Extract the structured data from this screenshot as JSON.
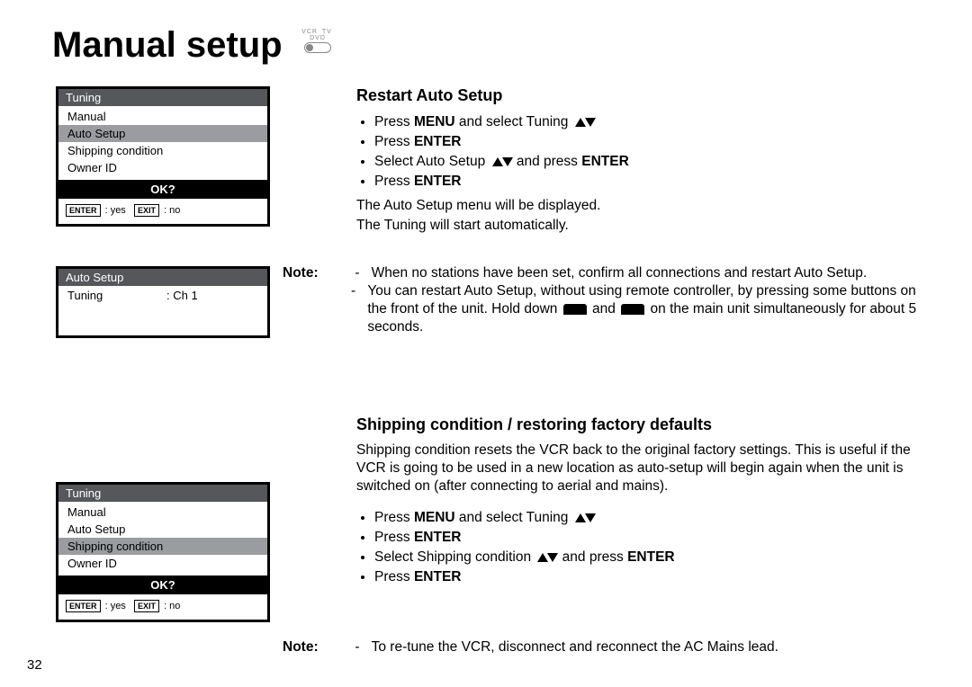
{
  "page_number": "32",
  "title": "Manual setup",
  "mode_icon": {
    "top": "TV",
    "left": "VCR",
    "right": "DVD"
  },
  "osd1": {
    "title": "Tuning",
    "items": [
      "Manual",
      "Auto Setup",
      "Shipping condition",
      "Owner ID"
    ],
    "selected_index": 1,
    "ok_label": "OK?",
    "hint_enter_label": "ENTER",
    "hint_enter_text": ": yes",
    "hint_exit_label": "EXIT",
    "hint_exit_text": ": no"
  },
  "osd2": {
    "title": "Auto Setup",
    "row_key": "Tuning",
    "row_val": ": Ch 1"
  },
  "osd3": {
    "title": "Tuning",
    "items": [
      "Manual",
      "Auto Setup",
      "Shipping condition",
      "Owner ID"
    ],
    "selected_index": 2,
    "ok_label": "OK?",
    "hint_enter_label": "ENTER",
    "hint_enter_text": ": yes",
    "hint_exit_label": "EXIT",
    "hint_exit_text": ": no"
  },
  "section1": {
    "heading": "Restart Auto Setup",
    "bullets": {
      "b1a": "Press ",
      "b1b": "MENU",
      "b1c": " and select Tuning ",
      "b2a": "Press ",
      "b2b": "ENTER",
      "b3a": "Select Auto Setup ",
      "b3b": " and press ",
      "b3c": "ENTER",
      "b4a": "Press ",
      "b4b": "ENTER"
    },
    "p1": "The Auto Setup menu will be displayed.",
    "p2": "The Tuning will start automatically."
  },
  "note1": {
    "label": "Note:",
    "n1": "When no stations have been set, confirm all connections and restart Auto Setup.",
    "n2a": "You can restart Auto Setup, without using remote controller, by pressing some buttons on the front of the unit. Hold down ",
    "n2b": " and ",
    "n2c": " on the main unit simultaneously for about 5 seconds."
  },
  "section2": {
    "heading": "Shipping condition / restoring factory defaults",
    "intro": "Shipping condition resets the VCR back to the original factory settings. This is useful if the VCR is going to be used in a new location as auto-setup will begin again when the unit is switched on (after connecting to aerial and mains).",
    "bullets": {
      "b1a": "Press ",
      "b1b": "MENU",
      "b1c": " and select Tuning ",
      "b2a": "Press ",
      "b2b": "ENTER",
      "b3a": "Select Shipping condition ",
      "b3b": " and press ",
      "b3c": "ENTER",
      "b4a": "Press ",
      "b4b": "ENTER"
    }
  },
  "note2": {
    "label": "Note:",
    "n1": "To re-tune the VCR, disconnect and reconnect the AC Mains lead."
  }
}
